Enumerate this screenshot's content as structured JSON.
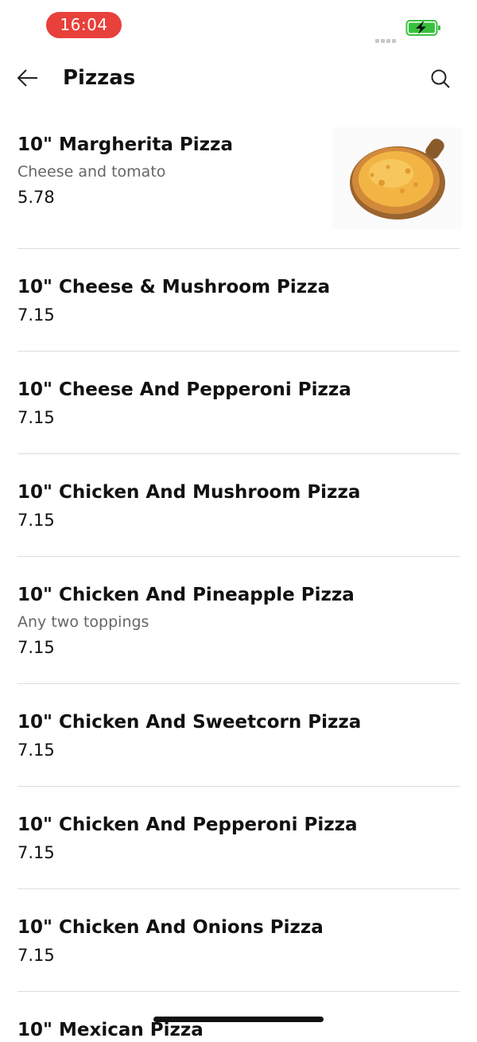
{
  "status_bar": {
    "time": "16:04",
    "signal_icon": "signal-dots-icon",
    "battery_icon": "battery-charging-icon",
    "accent_color": "#e8403a",
    "battery_color": "#38c13d"
  },
  "header": {
    "back_icon": "arrow-left-icon",
    "title": "Pizzas",
    "search_icon": "search-icon"
  },
  "items": [
    {
      "name": "10\" Margherita Pizza",
      "description": "Cheese and tomato",
      "price": "5.78",
      "image_icon": "pizza-image"
    },
    {
      "name": "10\" Cheese & Mushroom Pizza",
      "price": "7.15"
    },
    {
      "name": "10\" Cheese And Pepperoni Pizza",
      "price": "7.15"
    },
    {
      "name": "10\" Chicken And Mushroom Pizza",
      "price": "7.15"
    },
    {
      "name": "10\" Chicken And Pineapple Pizza",
      "description": "Any two toppings",
      "price": "7.15"
    },
    {
      "name": "10\" Chicken And Sweetcorn Pizza",
      "price": "7.15"
    },
    {
      "name": "10\" Chicken And Pepperoni Pizza",
      "price": "7.15"
    },
    {
      "name": "10\" Chicken And Onions Pizza",
      "price": "7.15"
    },
    {
      "name": "10\" Mexican Pizza"
    }
  ]
}
